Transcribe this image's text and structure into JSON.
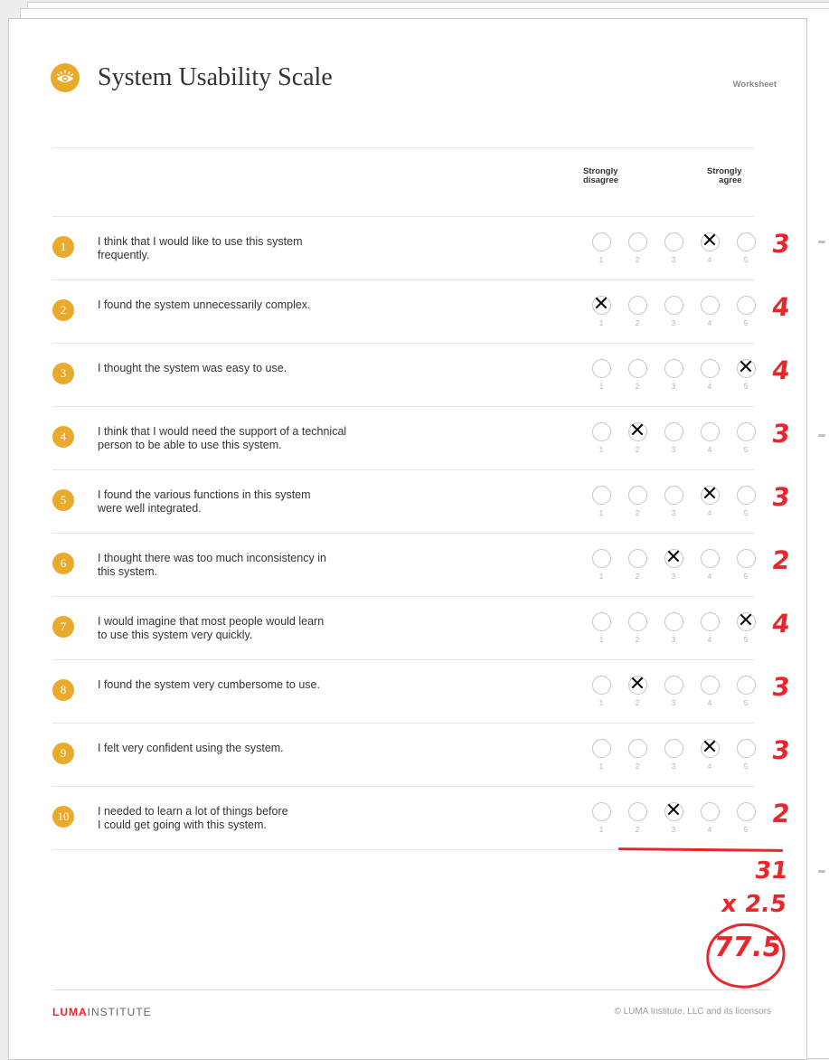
{
  "header": {
    "title": "System Usability Scale",
    "label": "Worksheet",
    "icon": "eye-icon"
  },
  "scale": {
    "low_label_1": "Strongly",
    "low_label_2": "disagree",
    "high_label_1": "Strongly",
    "high_label_2": "agree",
    "options": [
      "1",
      "2",
      "3",
      "4",
      "5"
    ]
  },
  "questions": [
    {
      "num": "1",
      "text_1": "I think that I would like to use this system",
      "text_2": "frequently.",
      "selected": 4,
      "score": "3"
    },
    {
      "num": "2",
      "text_1": "I found the system unnecessarily complex.",
      "text_2": "",
      "selected": 1,
      "score": "4"
    },
    {
      "num": "3",
      "text_1": "I thought the system was easy to use.",
      "text_2": "",
      "selected": 5,
      "score": "4"
    },
    {
      "num": "4",
      "text_1": "I think that I would need the support of a technical",
      "text_2": "person to be able to use this system.",
      "selected": 2,
      "score": "3"
    },
    {
      "num": "5",
      "text_1": "I found the various functions in this system",
      "text_2": "were well integrated.",
      "selected": 4,
      "score": "3"
    },
    {
      "num": "6",
      "text_1": "I thought there was too much inconsistency in",
      "text_2": "this system.",
      "selected": 3,
      "score": "2"
    },
    {
      "num": "7",
      "text_1": "I would imagine that most people would learn",
      "text_2": "to use this system very quickly.",
      "selected": 5,
      "score": "4"
    },
    {
      "num": "8",
      "text_1": "I found the system very cumbersome to use.",
      "text_2": "",
      "selected": 2,
      "score": "3"
    },
    {
      "num": "9",
      "text_1": "I felt very confident using the system.",
      "text_2": "",
      "selected": 4,
      "score": "3"
    },
    {
      "num": "10",
      "text_1": "I needed to learn a lot of things before",
      "text_2": "I could get going with this system.",
      "selected": 3,
      "score": "2"
    }
  ],
  "calculation": {
    "total": "31",
    "multiplier": "x 2.5",
    "result": "77.5"
  },
  "footer": {
    "brand_luma": "LUMA",
    "brand_institute": "INSTITUTE",
    "copyright": "© LUMA Institute, LLC and its licensors"
  },
  "colors": {
    "accent": "#e9aa2b",
    "handwriting": "#e8262b"
  }
}
